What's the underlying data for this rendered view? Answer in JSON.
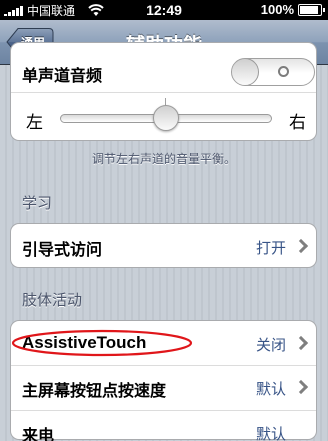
{
  "status_bar": {
    "carrier": "中国联通",
    "time": "12:49",
    "battery_percent": "100%",
    "battery_level": 1.0,
    "signal_bars": 5,
    "wifi": true
  },
  "nav": {
    "back_label": "通用",
    "title": "辅助功能"
  },
  "audio": {
    "mono_audio_label": "单声道音频",
    "mono_audio_on": false,
    "balance_left_label": "左",
    "balance_right_label": "右",
    "balance_value": 0.5,
    "balance_footnote": "调节左右声道的音量平衡。"
  },
  "learning": {
    "header": "学习",
    "guided_access_label": "引导式访问",
    "guided_access_value": "打开"
  },
  "physical_motor": {
    "header": "肢体活动",
    "assistive_touch_label": "AssistiveTouch",
    "assistive_touch_value": "关闭",
    "home_click_speed_label": "主屏幕按钮点按速度",
    "home_click_speed_value": "默认",
    "partial_row_label": "来电",
    "partial_row_value": "默认"
  },
  "colors": {
    "value_text": "#385487",
    "annotation": "#e0161a"
  }
}
